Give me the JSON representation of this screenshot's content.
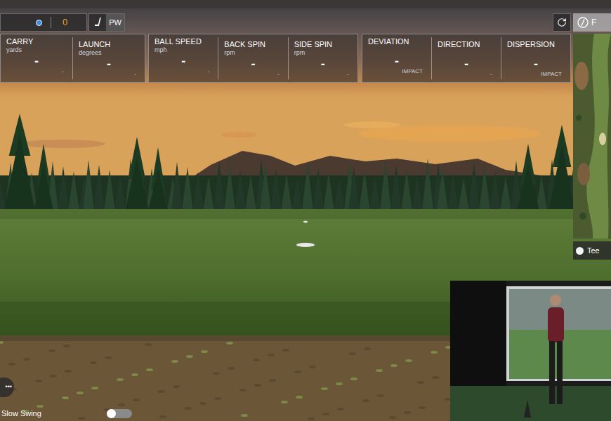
{
  "top_bar": {
    "indicator": "0",
    "club": "PW"
  },
  "stat_panels": [
    {
      "stats": [
        {
          "label": "CARRY",
          "unit": "yards",
          "value": "-",
          "foot": "-"
        },
        {
          "label": "LAUNCH",
          "unit": "degrees",
          "value": "-",
          "foot": "-"
        }
      ]
    },
    {
      "stats": [
        {
          "label": "BALL SPEED",
          "unit": "mph",
          "value": "-",
          "foot": "-"
        },
        {
          "label": "BACK SPIN",
          "unit": "rpm",
          "value": "-",
          "foot": "-"
        },
        {
          "label": "SIDE SPIN",
          "unit": "rpm",
          "value": "-",
          "foot": "-"
        }
      ]
    },
    {
      "stats": [
        {
          "label": "DEVIATION",
          "value": "-",
          "foot": "IMPACT"
        },
        {
          "label": "DIRECTION",
          "value": "-",
          "foot": "-"
        },
        {
          "label": "DISPERSION",
          "value": "-",
          "foot": "IMPACT"
        }
      ]
    }
  ],
  "logo": {
    "text": "F"
  },
  "minimap": {
    "marker": "Tee"
  },
  "menu_button": {
    "label": "•••"
  },
  "slow_swing": {
    "label": "Slow Swing",
    "on": false
  }
}
